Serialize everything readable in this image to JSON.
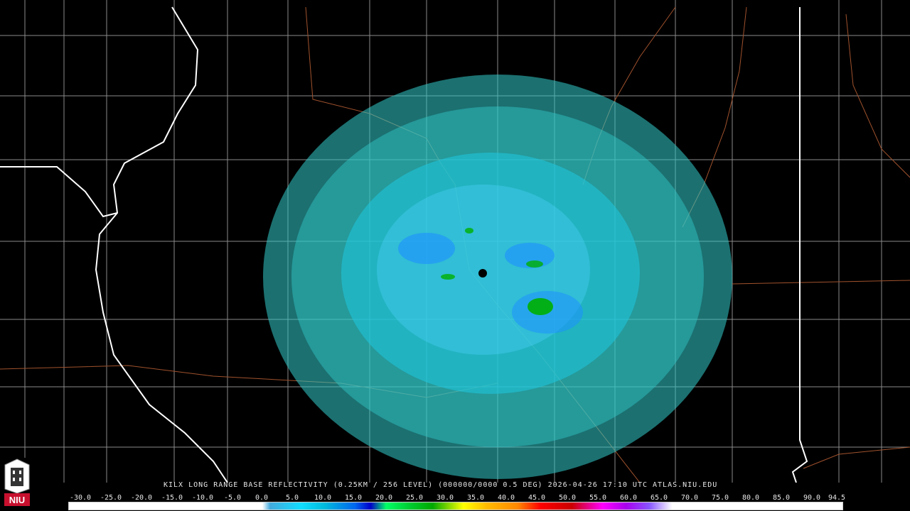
{
  "title": "KILX LONG RANGE BASE REFLECTIVITY (0.25KM / 256 LEVEL) (000000/0000 0.5 DEG) 2026-04-26 17:10 UTC  ATLAS.NIU.EDU",
  "scale": {
    "labels": [
      "-30.0",
      "-25.0",
      "-20.0",
      "-15.0",
      "-10.0",
      "-5.0",
      "0.0",
      "5.0",
      "10.0",
      "15.0",
      "20.0",
      "25.0",
      "30.0",
      "35.0",
      "40.0",
      "45.0",
      "50.0",
      "55.0",
      "60.0",
      "65.0",
      "70.0",
      "75.0",
      "80.0",
      "85.0",
      "90.0",
      "94.5"
    ]
  },
  "logo": {
    "text": "NIU"
  },
  "radar": {
    "site": "KILX"
  },
  "colors": {
    "background": "#000000",
    "county_lines": "#8a8a8a",
    "state_lines": "#ffffff",
    "highways": "#a0522d",
    "light_echo": "#33cccc",
    "moderate_echo": "#1e90ff",
    "heavy_echo": "#00b000"
  }
}
